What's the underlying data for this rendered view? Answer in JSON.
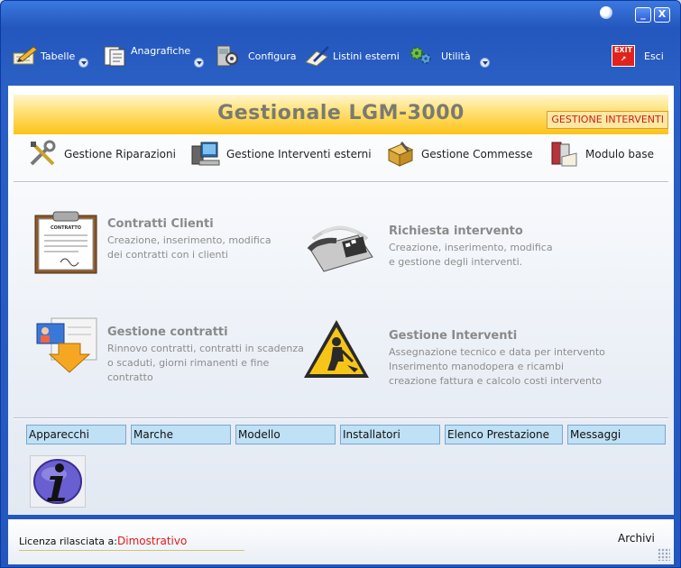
{
  "window": {
    "help_label": "?",
    "minimize_label": "_",
    "close_label": "X"
  },
  "menu": {
    "items": [
      {
        "label": "Tabelle",
        "icon": "pencil-paper-icon"
      },
      {
        "label": "Anagrafiche",
        "icon": "documents-icon"
      },
      {
        "label": "Configura",
        "icon": "gear-cabinet-icon"
      },
      {
        "label": "Listini esterni",
        "icon": "pen-paper-icon"
      },
      {
        "label": "Utilità",
        "icon": "gears-icon"
      }
    ],
    "exit_icon_text": "EXIT",
    "exit_label": "Esci"
  },
  "banner": {
    "title": "Gestionale LGM-3000",
    "tag": "GESTIONE INTERVENTI"
  },
  "modules": [
    {
      "label": "Gestione Riparazioni",
      "icon": "tools-icon"
    },
    {
      "label": "Gestione Interventi esterni",
      "icon": "computer-icon"
    },
    {
      "label": "Gestione Commesse",
      "icon": "box-icon"
    },
    {
      "label": "Modulo base",
      "icon": "books-icon"
    }
  ],
  "features": {
    "contratti_clienti": {
      "title": "Contratti Clienti",
      "desc1": "Creazione, inserimento, modifica",
      "desc2": "dei contratti con i clienti",
      "doc_text": "CONTRATTO"
    },
    "richiesta_intervento": {
      "title": "Richiesta intervento",
      "desc1": "Creazione, inserimento, modifica",
      "desc2": "e gestione degli interventi."
    },
    "gestione_contratti": {
      "title": "Gestione contratti",
      "desc1": "Rinnovo contratti, contratti in scadenza",
      "desc2": "o scaduti, giorni rimanenti e fine",
      "desc3": "contratto"
    },
    "gestione_interventi": {
      "title": "Gestione Interventi",
      "desc1": "Assegnazione tecnico e data per intervento",
      "desc2": "Inserimento manodopera e ricambi",
      "desc3": "creazione fattura e calcolo costi intervento"
    }
  },
  "tabs": [
    "Apparecchi",
    "Marche",
    "Modello",
    "Installatori",
    "Elenco Prestazione",
    "Messaggi"
  ],
  "status": {
    "license_label": "Licenza rilasciata a:",
    "license_value": "Dimostrativo",
    "archivi_label": "Archivi"
  },
  "colors": {
    "titlebar": "#2457bd",
    "banner": "#fcc318",
    "tag_text": "#c82020",
    "tab_bg": "#bfe0f5",
    "license_value": "#e01a1a"
  }
}
